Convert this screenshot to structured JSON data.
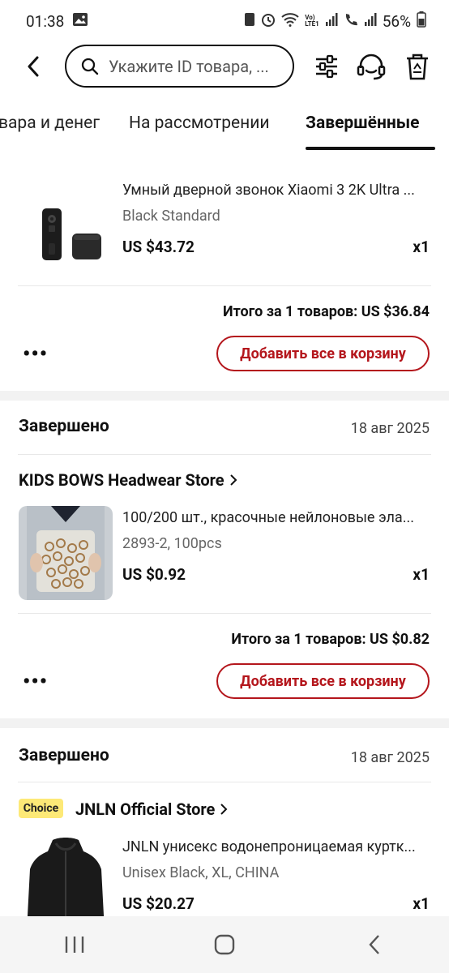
{
  "status_bar": {
    "time": "01:38",
    "battery": "56%"
  },
  "header": {
    "search_placeholder": "Укажите ID товара, ..."
  },
  "tabs": [
    {
      "label": "вара и денег"
    },
    {
      "label": "На рассмотрении"
    },
    {
      "label": "Завершённые"
    }
  ],
  "orders": [
    {
      "product": {
        "title": "Умный дверной звонок Xiaomi 3 2K Ultra ...",
        "variant": "Black Standard",
        "price": "US $43.72",
        "qty": "x1"
      },
      "total": "Итого за 1 товаров: US $36.84",
      "add_all_label": "Добавить все в корзину",
      "more": "•••"
    },
    {
      "status": "Завершено",
      "date": "18 авг 2025",
      "store": "KIDS BOWS Headwear Store",
      "product": {
        "title": "100/200 шт., красочные нейлоновые эла...",
        "variant": "2893-2, 100pcs",
        "price": "US $0.92",
        "qty": "x1"
      },
      "total": "Итого за 1 товаров: US $0.82",
      "add_all_label": "Добавить все в корзину",
      "more": "•••"
    },
    {
      "status": "Завершено",
      "date": "18 авг 2025",
      "badge": "Choice",
      "store": "JNLN Official Store",
      "product": {
        "title": "JNLN унисекс водонепроницаемая куртк...",
        "variant": "Unisex Black, XL, CHINA",
        "price": "US $20.27",
        "qty": "x1"
      }
    }
  ],
  "colors": {
    "accent": "#b4161c",
    "choice_badge": "#fde977",
    "separator": "#f2f2f2"
  }
}
